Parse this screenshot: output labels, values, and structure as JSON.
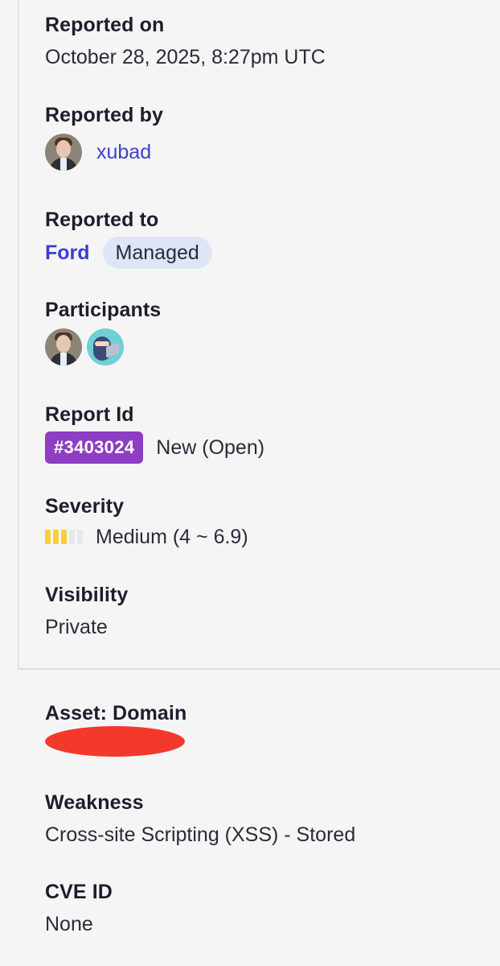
{
  "reported_on": {
    "label": "Reported on",
    "value": "October 28, 2025, 8:27pm UTC"
  },
  "reported_by": {
    "label": "Reported by",
    "username": "xubad",
    "avatar_icon": "user-avatar-icon"
  },
  "reported_to": {
    "label": "Reported to",
    "program": "Ford",
    "tag": "Managed"
  },
  "participants": {
    "label": "Participants",
    "avatars": [
      "user-avatar-icon",
      "ninja-hacker-avatar-icon"
    ]
  },
  "report_id": {
    "label": "Report Id",
    "id": "#3403024",
    "status": "New (Open)",
    "badge_color": "#8e3ec4"
  },
  "severity": {
    "label": "Severity",
    "value": "Medium (4 ~ 6.9)",
    "filled_segments": 3,
    "total_segments": 5,
    "filled_color": "#f5cf3c",
    "empty_color": "#e7e8ee"
  },
  "visibility": {
    "label": "Visibility",
    "value": "Private"
  },
  "asset": {
    "label": "Asset: Domain",
    "redaction_color": "#f2392c"
  },
  "weakness": {
    "label": "Weakness",
    "value": "Cross-site Scripting (XSS) - Stored"
  },
  "cve": {
    "label": "CVE ID",
    "value": "None"
  },
  "colors": {
    "link": "#3b3fce",
    "pill_bg": "#dde5f6",
    "background": "#f6f5f6"
  }
}
